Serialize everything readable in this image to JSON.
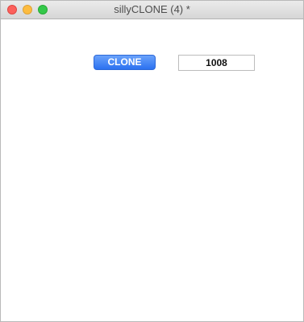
{
  "window": {
    "title": "sillyCLONE (4) *"
  },
  "main": {
    "clone_label": "CLONE",
    "value": "1008"
  },
  "colors": {
    "accent": "#2b71f0",
    "close": "#fc605c",
    "minimize": "#fdbc40",
    "maximize": "#34c84a"
  }
}
